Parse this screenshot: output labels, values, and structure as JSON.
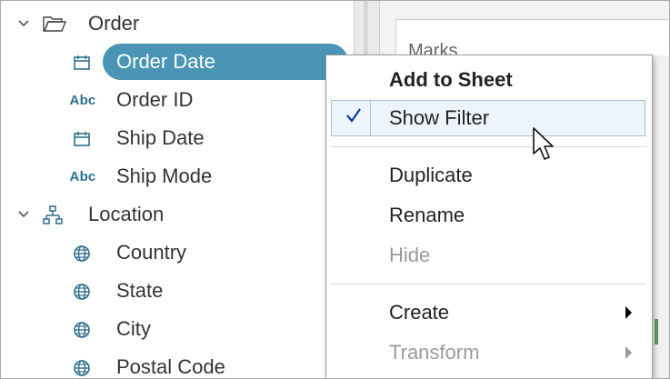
{
  "data_pane": {
    "groups": [
      {
        "label": "Order",
        "fields": [
          {
            "label": "Order Date",
            "type": "date",
            "selected": true
          },
          {
            "label": "Order ID",
            "type": "string",
            "type_label": "Abc"
          },
          {
            "label": "Ship Date",
            "type": "date"
          },
          {
            "label": "Ship Mode",
            "type": "string",
            "type_label": "Abc"
          }
        ]
      },
      {
        "label": "Location",
        "fields": [
          {
            "label": "Country",
            "type": "geo"
          },
          {
            "label": "State",
            "type": "geo"
          },
          {
            "label": "City",
            "type": "geo"
          },
          {
            "label": "Postal Code",
            "type": "geo"
          }
        ]
      }
    ]
  },
  "right_pane": {
    "marks_title": "Marks"
  },
  "context_menu": {
    "items": [
      {
        "label": "Add to Sheet",
        "bold": true
      },
      {
        "label": "Show Filter",
        "checked": true
      },
      {
        "label": "Duplicate"
      },
      {
        "label": "Rename"
      },
      {
        "label": "Hide",
        "disabled": true
      },
      {
        "label": "Create",
        "submenu": true
      },
      {
        "label": "Transform",
        "submenu": true,
        "disabled": true
      }
    ]
  },
  "icons": {
    "folder": "folder-open-icon",
    "hierarchy": "hierarchy-icon",
    "date": "calendar-icon",
    "geo": "globe-icon",
    "check": "checkmark-icon",
    "cursor": "mouse-pointer-icon"
  },
  "colors": {
    "pill": "#4a95b5",
    "check": "#0b3f9f",
    "hover_border": "#a6c2dd",
    "disabled_text": "#9b9b9b"
  }
}
